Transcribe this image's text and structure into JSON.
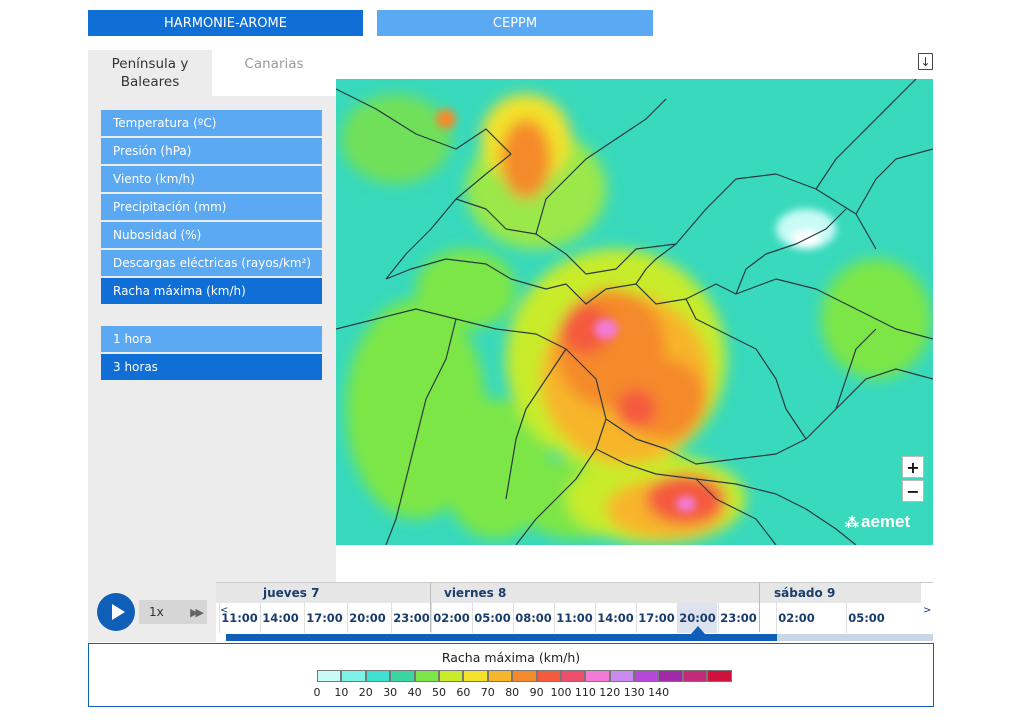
{
  "model_tabs": [
    {
      "label": "HARMONIE-AROME",
      "active": true
    },
    {
      "label": "CEPPM",
      "active": false
    }
  ],
  "region_tabs": [
    {
      "label": "Península y Baleares",
      "active": true
    },
    {
      "label": "Canarias",
      "active": false
    }
  ],
  "variables": [
    {
      "label": "Temperatura (ºC)",
      "selected": false
    },
    {
      "label": "Presión (hPa)",
      "selected": false
    },
    {
      "label": "Viento (km/h)",
      "selected": false
    },
    {
      "label": "Precipitación (mm)",
      "selected": false
    },
    {
      "label": "Nubosidad (%)",
      "selected": false
    },
    {
      "label": "Descargas eléctricas (rayos/km²)",
      "selected": false
    },
    {
      "label": "Racha máxima (km/h)",
      "selected": true
    }
  ],
  "periods": [
    {
      "label": "1 hora",
      "selected": false
    },
    {
      "label": "3 horas",
      "selected": true
    }
  ],
  "map": {
    "logo_text": "aemet",
    "zoom_in": "+",
    "zoom_out": "−",
    "download_icon": "download-icon"
  },
  "player": {
    "speed": "1x"
  },
  "timeline": {
    "days": [
      "jueves 7",
      "viernes 8",
      "sábado 9"
    ],
    "hours": [
      "11:00",
      "14:00",
      "17:00",
      "20:00",
      "23:00",
      "02:00",
      "05:00",
      "08:00",
      "11:00",
      "14:00",
      "17:00",
      "20:00",
      "23:00",
      "02:00",
      "05:00"
    ],
    "current_index": 11,
    "scroll_left": "<",
    "scroll_right": ">"
  },
  "legend": {
    "title": "Racha máxima (km/h)",
    "colors": [
      "#c9fbf6",
      "#7ff2e8",
      "#3ee0d2",
      "#39d6a0",
      "#7be646",
      "#c8ec2a",
      "#f2e22a",
      "#f7b52b",
      "#f58a2c",
      "#f45a3c",
      "#ef4f6a",
      "#f47ad8",
      "#c98bf0",
      "#b548d8",
      "#a02aa8",
      "#c42a7a",
      "#d0103e"
    ],
    "ticks": [
      "0",
      "10",
      "20",
      "30",
      "40",
      "50",
      "60",
      "70",
      "80",
      "90",
      "100",
      "110",
      "120",
      "130",
      "140"
    ]
  }
}
